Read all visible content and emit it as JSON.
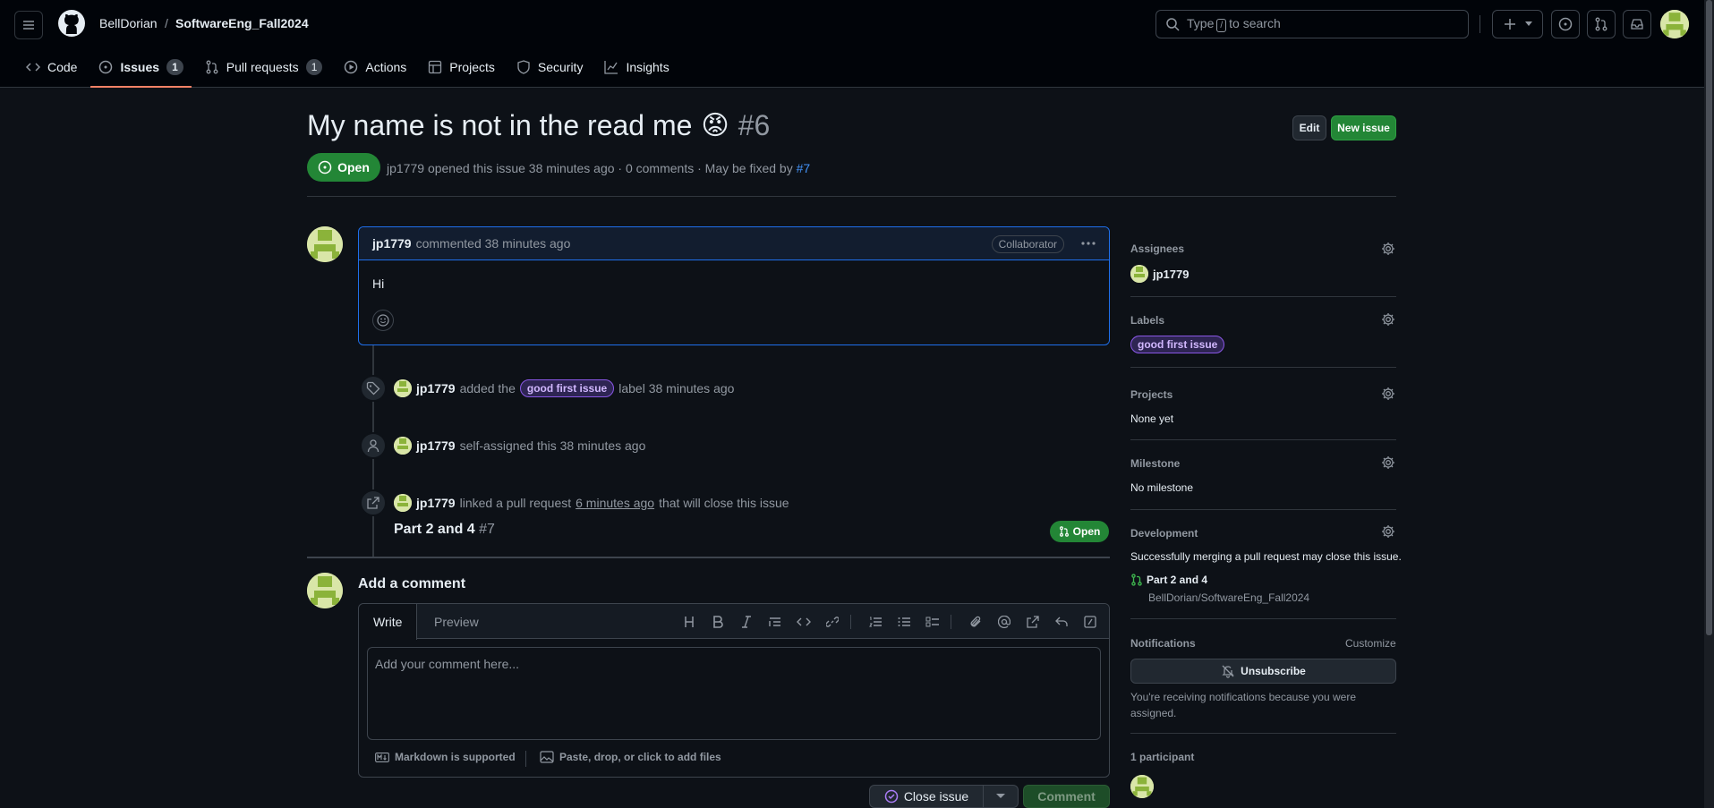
{
  "header": {
    "owner": "BellDorian",
    "separator": "/",
    "repo": "SoftwareEng_Fall2024",
    "search_prefix": "Type",
    "search_key": "/",
    "search_suffix": "to search"
  },
  "tabs": [
    {
      "label": "Code",
      "count": ""
    },
    {
      "label": "Issues",
      "count": "1"
    },
    {
      "label": "Pull requests",
      "count": "1"
    },
    {
      "label": "Actions",
      "count": ""
    },
    {
      "label": "Projects",
      "count": ""
    },
    {
      "label": "Security",
      "count": ""
    },
    {
      "label": "Insights",
      "count": ""
    }
  ],
  "issue": {
    "title": "My name is not in the read me",
    "emoji": "😡",
    "number": "#6",
    "edit_label": "Edit",
    "new_issue_label": "New issue",
    "state": "Open",
    "author": "jp1779",
    "meta_text": "opened this issue 38 minutes ago · 0 comments · May be fixed by",
    "fix_link": "#7"
  },
  "comment": {
    "author": "jp1779",
    "when": "commented 38 minutes ago",
    "role": "Collaborator",
    "body": "Hi"
  },
  "timeline": {
    "label_event": {
      "user": "jp1779",
      "pre": "added the",
      "label": "good first issue",
      "post": "label 38 minutes ago"
    },
    "assign_event": {
      "user": "jp1779",
      "text": "self-assigned this 38 minutes ago"
    },
    "link_event": {
      "user": "jp1779",
      "pre": "linked a pull request",
      "when": "6 minutes ago",
      "post": "that will close this issue"
    },
    "pr": {
      "title": "Part 2 and 4",
      "number": "#7",
      "state": "Open"
    }
  },
  "compose": {
    "heading": "Add a comment",
    "write_tab": "Write",
    "preview_tab": "Preview",
    "placeholder": "Add your comment here...",
    "markdown_note": "Markdown is supported",
    "files_note": "Paste, drop, or click to add files",
    "close_issue": "Close issue",
    "comment_button": "Comment"
  },
  "sidebar": {
    "assignees_h": "Assignees",
    "assignee": "jp1779",
    "labels_h": "Labels",
    "label": "good first issue",
    "projects_h": "Projects",
    "projects_v": "None yet",
    "milestone_h": "Milestone",
    "milestone_v": "No milestone",
    "development_h": "Development",
    "development_note": "Successfully merging a pull request may close this issue.",
    "dev_pr": "Part 2 and 4",
    "dev_repo": "BellDorian/SoftwareEng_Fall2024",
    "notifications_h": "Notifications",
    "customize": "Customize",
    "unsubscribe": "Unsubscribe",
    "notif_reason": "You're receiving notifications because you were assigned.",
    "participants": "1 participant"
  },
  "colors": {
    "accent_green": "#238636",
    "link_blue": "#4493f8",
    "tab_underline": "#f78166",
    "label_purple": "#8957e5"
  }
}
